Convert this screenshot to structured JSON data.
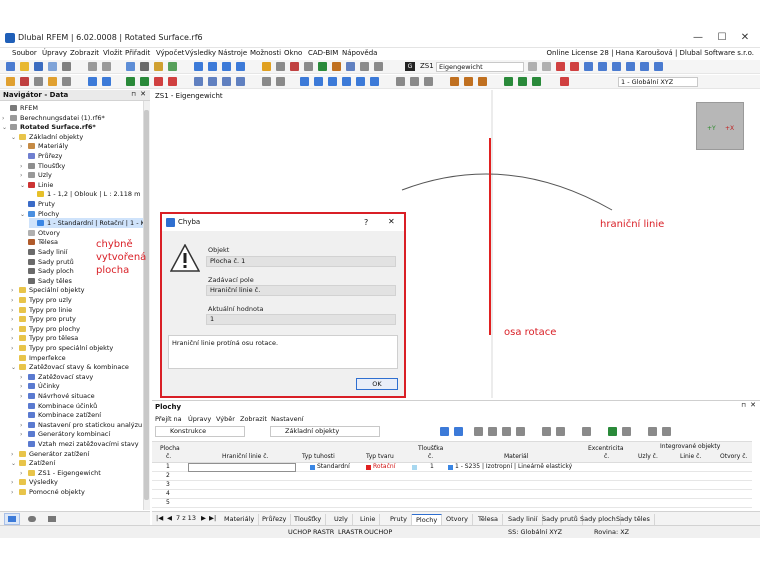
{
  "window": {
    "title": "Dlubal RFEM | 6.02.0008 | Rotated Surface.rf6",
    "controls": [
      "—",
      "☐",
      "✕"
    ]
  },
  "menu": {
    "items": [
      "Soubor",
      "Úpravy",
      "Zobrazit",
      "Vložit",
      "Přiřadit",
      "Výpočet",
      "Výsledky",
      "Nástroje",
      "Možnosti",
      "Okno",
      "CAD-BIM",
      "Nápověda"
    ],
    "license": "Online License 28 | Hana Karoušová | Dlubal Software s.r.o."
  },
  "toolbar": {
    "loadcase_tag": "G",
    "loadcase_code": "ZS1",
    "loadcase_name": "Eigengewicht",
    "coord_system": "1 - Globální XYZ"
  },
  "navigator": {
    "title": "Navigátor - Data",
    "rows": [
      {
        "label": "RFEM",
        "level": 0,
        "tw": "",
        "color": "#7a7a7a"
      },
      {
        "label": "Berechnungsdatei (1).rf6*",
        "level": 0,
        "tw": "›",
        "color": "#9a9a9a"
      },
      {
        "label": "Rotated Surface.rf6*",
        "level": 0,
        "tw": "⌄",
        "color": "#9a9a9a",
        "bold": true
      },
      {
        "label": "Základní objekty",
        "level": 1,
        "tw": "⌄",
        "color": "#e8c44a"
      },
      {
        "label": "Materiály",
        "level": 2,
        "tw": "›",
        "color": "#c58a44"
      },
      {
        "label": "Průřezy",
        "level": 2,
        "tw": "",
        "color": "#6f7fd0"
      },
      {
        "label": "Tloušťky",
        "level": 2,
        "tw": "›",
        "color": "#8f8f8f"
      },
      {
        "label": "Uzly",
        "level": 2,
        "tw": "›",
        "color": "#999"
      },
      {
        "label": "Linie",
        "level": 2,
        "tw": "⌄",
        "color": "#c33"
      },
      {
        "label": "1 - 1,2 | Oblouk | L : 2.118 m",
        "level": 3,
        "tw": "",
        "color": "#e6c02a"
      },
      {
        "label": "Pruty",
        "level": 2,
        "tw": "",
        "color": "#3a6bc7"
      },
      {
        "label": "Plochy",
        "level": 2,
        "tw": "⌄",
        "color": "#4a8fe0"
      },
      {
        "label": "1 - Standardní | Rotační | 1 - K",
        "level": 3,
        "tw": "",
        "color": "#3a86e4",
        "selected": true
      },
      {
        "label": "Otvory",
        "level": 2,
        "tw": "",
        "color": "#b0b0b0"
      },
      {
        "label": "Tělesa",
        "level": 2,
        "tw": "",
        "color": "#b05a2a"
      },
      {
        "label": "Sady linií",
        "level": 2,
        "tw": "",
        "color": "#6a6a6a"
      },
      {
        "label": "Sady prutů",
        "level": 2,
        "tw": "",
        "color": "#6a6a6a"
      },
      {
        "label": "Sady ploch",
        "level": 2,
        "tw": "",
        "color": "#6a6a6a"
      },
      {
        "label": "Sady těles",
        "level": 2,
        "tw": "",
        "color": "#6a6a6a"
      },
      {
        "label": "Speciální objekty",
        "level": 1,
        "tw": "›",
        "color": "#e8c44a"
      },
      {
        "label": "Typy pro uzly",
        "level": 1,
        "tw": "›",
        "color": "#e8c44a"
      },
      {
        "label": "Typy pro linie",
        "level": 1,
        "tw": "›",
        "color": "#e8c44a"
      },
      {
        "label": "Typy pro pruty",
        "level": 1,
        "tw": "›",
        "color": "#e8c44a"
      },
      {
        "label": "Typy pro plochy",
        "level": 1,
        "tw": "›",
        "color": "#e8c44a"
      },
      {
        "label": "Typy pro tělesa",
        "level": 1,
        "tw": "›",
        "color": "#e8c44a"
      },
      {
        "label": "Typy pro speciální objekty",
        "level": 1,
        "tw": "›",
        "color": "#e8c44a"
      },
      {
        "label": "Imperfekce",
        "level": 1,
        "tw": "",
        "color": "#e8c44a"
      },
      {
        "label": "Zatěžovací stavy & kombinace",
        "level": 1,
        "tw": "⌄",
        "color": "#e8c44a"
      },
      {
        "label": "Zatěžovací stavy",
        "level": 2,
        "tw": "›",
        "color": "#5a7ad0"
      },
      {
        "label": "Účinky",
        "level": 2,
        "tw": "›",
        "color": "#5a7ad0"
      },
      {
        "label": "Návrhové situace",
        "level": 2,
        "tw": "›",
        "color": "#5a7ad0"
      },
      {
        "label": "Kombinace účinků",
        "level": 2,
        "tw": "",
        "color": "#5a7ad0"
      },
      {
        "label": "Kombinace zatížení",
        "level": 2,
        "tw": "",
        "color": "#5a7ad0"
      },
      {
        "label": "Nastavení pro statickou analýzu",
        "level": 2,
        "tw": "›",
        "color": "#5a7ad0"
      },
      {
        "label": "Generátory kombinací",
        "level": 2,
        "tw": "›",
        "color": "#5a7ad0"
      },
      {
        "label": "Vztah mezi zatěžovacími stavy",
        "level": 2,
        "tw": "",
        "color": "#5a7ad0"
      },
      {
        "label": "Generátor zatížení",
        "level": 1,
        "tw": "›",
        "color": "#e8c44a"
      },
      {
        "label": "Zatížení",
        "level": 1,
        "tw": "⌄",
        "color": "#e8c44a"
      },
      {
        "label": "ZS1 - Eigengewicht",
        "level": 2,
        "tw": "›",
        "color": "#e8c44a"
      },
      {
        "label": "Výsledky",
        "level": 1,
        "tw": "›",
        "color": "#e8c44a"
      },
      {
        "label": "Pomocné objekty",
        "level": 1,
        "tw": "›",
        "color": "#e8c44a"
      }
    ]
  },
  "viewport": {
    "label": "ZS1 - Eigengewicht"
  },
  "annotations": {
    "wrong_surface": [
      "chybně",
      "vytvořená",
      "plocha"
    ],
    "boundary_line": "hraniční linie",
    "rotation_axis": "osa rotace"
  },
  "dialog": {
    "title": "Chyba",
    "help": "?",
    "close": "✕",
    "object_label": "Objekt",
    "object_value": "Plocha č. 1",
    "input_label": "Zadávací pole",
    "input_value": "Hraniční linie č.",
    "current_label": "Aktuální hodnota",
    "current_value": "1",
    "message": "Hraniční linie protíná osu rotace.",
    "ok": "OK"
  },
  "panel": {
    "title": "Plochy",
    "menu": [
      "Přejít na",
      "Úpravy",
      "Výběr",
      "Zobrazit",
      "Nastavení"
    ],
    "combo1": "Konstrukce",
    "combo2": "Základní objekty",
    "columns": {
      "no_top": "Plocha",
      "no_bottom": "č.",
      "boundary": "Hraniční linie č.",
      "stiffness": "Typ tuhosti",
      "geometry": "Typ tvaru",
      "thick_top": "Tloušťka",
      "thick_bottom": "č.",
      "material": "Materiál",
      "ecc_top": "Excentricita",
      "ecc_bottom": "č.",
      "integrated": "Integrované objekty",
      "nodes": "Uzly č.",
      "lines": "Linie č.",
      "openings": "Otvory č."
    },
    "rows": [
      {
        "no": "1",
        "boundary": "",
        "stiffness": "Standardní",
        "geometry": "Rotační",
        "thickness": "1",
        "material": "1 - S235 | Izotropní | Lineárně elastický"
      },
      {
        "no": "2"
      },
      {
        "no": "3"
      },
      {
        "no": "4"
      },
      {
        "no": "5"
      }
    ],
    "page": "7 z 13"
  },
  "tabs": [
    "Materiály",
    "Průřezy",
    "Tloušťky",
    "Uzly",
    "Linie",
    "Pruty",
    "Plochy",
    "Otvory",
    "Tělesa",
    "Sady linií",
    "Sady prutů",
    "Sady ploch",
    "Sady těles"
  ],
  "active_tab": "Plochy",
  "status": {
    "items": [
      "UCHOP",
      "RASTR",
      "LRASTR",
      "OUCHOP"
    ],
    "cs": "SS: Globální XYZ",
    "plane": "Rovina: XZ"
  }
}
